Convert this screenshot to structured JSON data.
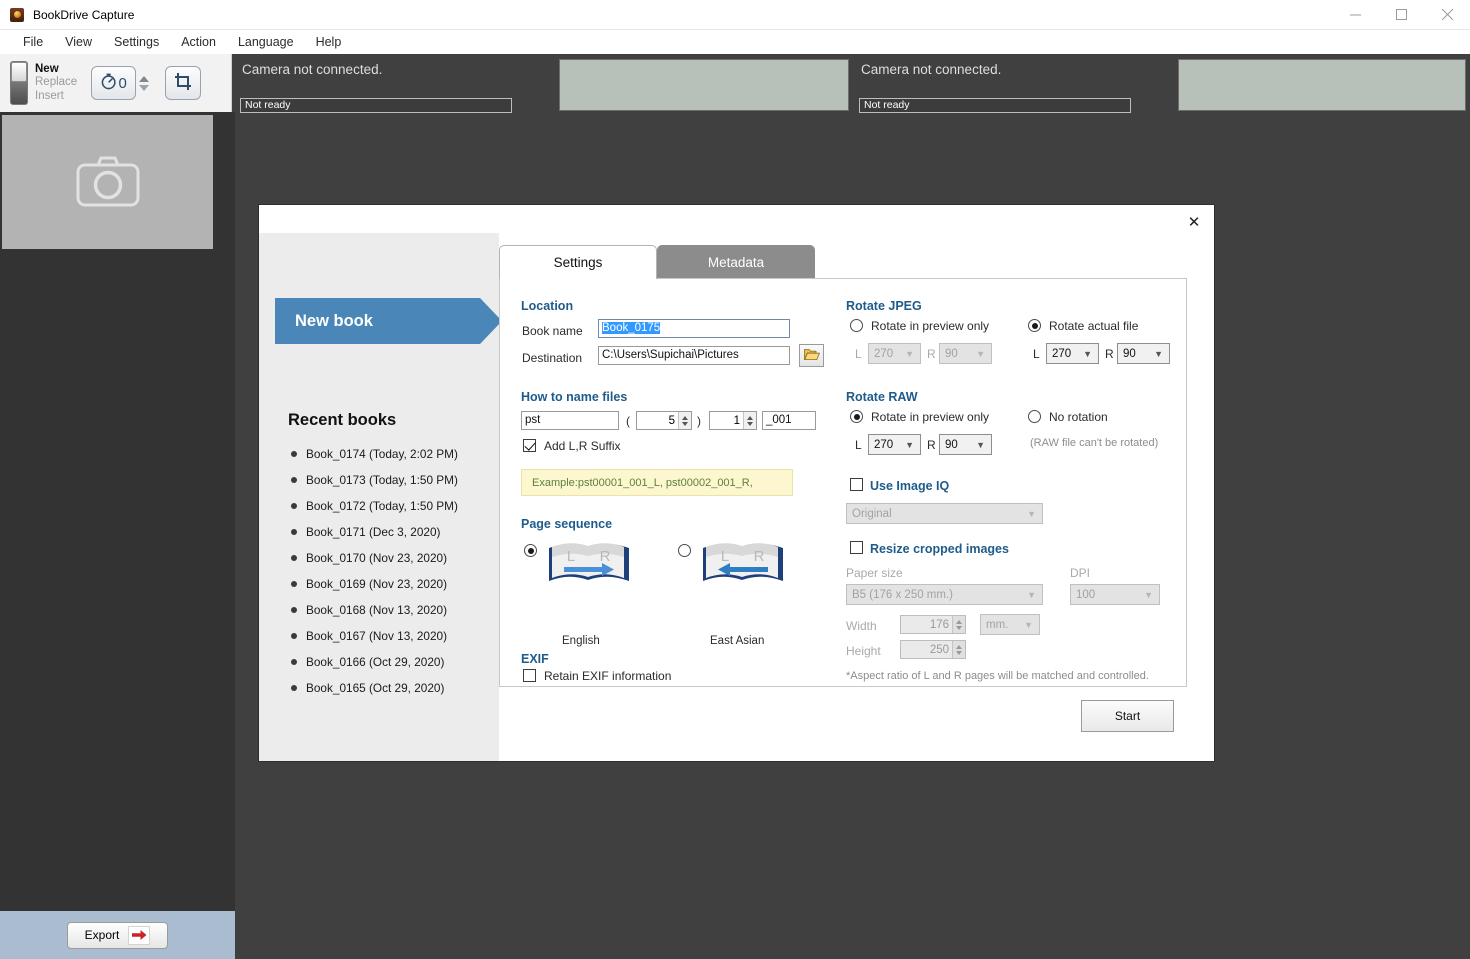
{
  "window": {
    "title": "BookDrive Capture",
    "app_icon": "camera-app-icon",
    "minimize": "—",
    "maximize": "□",
    "close": "✕"
  },
  "menubar": {
    "items": [
      "File",
      "View",
      "Settings",
      "Action",
      "Language",
      "Help"
    ]
  },
  "toolbar": {
    "mode_options": [
      "New",
      "Replace",
      "Insert"
    ],
    "mode_selected": "New",
    "timer_value": "0",
    "timer_icon": "timer-icon",
    "crop_icon": "crop-icon"
  },
  "cameras": [
    {
      "message": "Camera not connected.",
      "status": "Not ready",
      "empty": false
    },
    {
      "message": "",
      "status": "",
      "empty": true
    },
    {
      "message": "Camera not connected.",
      "status": "Not ready",
      "empty": false
    },
    {
      "message": "",
      "status": "",
      "empty": true
    }
  ],
  "preview": {
    "placeholder_icon": "camera-placeholder-icon"
  },
  "export": {
    "label": "Export",
    "arrow_icon": "red-arrow-right-icon"
  },
  "dialog": {
    "close_label": "✕",
    "new_book_label": "New book",
    "recent_title": "Recent books",
    "recent_books": [
      "Book_0174 (Today, 2:02 PM)",
      "Book_0173 (Today, 1:50 PM)",
      "Book_0172 (Today, 1:50 PM)",
      "Book_0171 (Dec 3, 2020)",
      "Book_0170 (Nov 23, 2020)",
      "Book_0169 (Nov 23, 2020)",
      "Book_0168 (Nov 13, 2020)",
      "Book_0167 (Nov 13, 2020)",
      "Book_0166 (Oct 29, 2020)",
      "Book_0165 (Oct 29, 2020)"
    ],
    "tabs": [
      {
        "label": "Settings",
        "active": true
      },
      {
        "label": "Metadata",
        "active": false
      }
    ],
    "location": {
      "heading": "Location",
      "book_name_label": "Book name",
      "book_name_value": "Book_0175",
      "destination_label": "Destination",
      "destination_value": "C:\\Users\\Supichai\\Pictures",
      "browse_icon": "folder-open-icon"
    },
    "naming": {
      "heading": "How to name files",
      "prefix_value": "pst",
      "open_paren": "(",
      "digits_value": "5",
      "close_paren": ")",
      "start_value": "1",
      "suffix_value": "_001",
      "add_lr_label": "Add L,R Suffix",
      "add_lr_checked": true,
      "example_text": "Example:pst00001_001_L, pst00002_001_R,"
    },
    "page_sequence": {
      "heading": "Page sequence",
      "options": [
        {
          "label": "English",
          "selected": true,
          "icon": "book-left-to-right-icon"
        },
        {
          "label": "East Asian",
          "selected": false,
          "icon": "book-right-to-left-icon"
        }
      ],
      "page_left_letter": "L",
      "page_right_letter": "R"
    },
    "exif": {
      "heading": "EXIF",
      "retain_label": "Retain EXIF information",
      "retain_checked": false
    },
    "rotate_jpeg": {
      "heading": "Rotate JPEG",
      "preview_only_label": "Rotate in preview only",
      "preview_only_selected": false,
      "preview_l_label": "L",
      "preview_l_value": "270",
      "preview_r_label": "R",
      "preview_r_value": "90",
      "actual_file_label": "Rotate actual file",
      "actual_file_selected": true,
      "actual_l_label": "L",
      "actual_l_value": "270",
      "actual_r_label": "R",
      "actual_r_value": "90"
    },
    "rotate_raw": {
      "heading": "Rotate RAW",
      "preview_only_label": "Rotate in preview only",
      "preview_only_selected": true,
      "l_label": "L",
      "l_value": "270",
      "r_label": "R",
      "r_value": "90",
      "no_rotation_label": "No rotation",
      "no_rotation_selected": false,
      "no_rotation_note": "(RAW file can't be rotated)"
    },
    "image_iq": {
      "label": "Use Image IQ",
      "checked": false,
      "profile_value": "Original"
    },
    "resize": {
      "label": "Resize cropped images",
      "checked": false,
      "paper_size_label": "Paper size",
      "paper_size_value": "B5 (176 x 250 mm.)",
      "dpi_label": "DPI",
      "dpi_value": "100",
      "width_label": "Width",
      "width_value": "176",
      "unit_value": "mm.",
      "height_label": "Height",
      "height_value": "250",
      "aspect_note": "*Aspect ratio of L and R pages will be matched and controlled."
    },
    "start_label": "Start"
  }
}
